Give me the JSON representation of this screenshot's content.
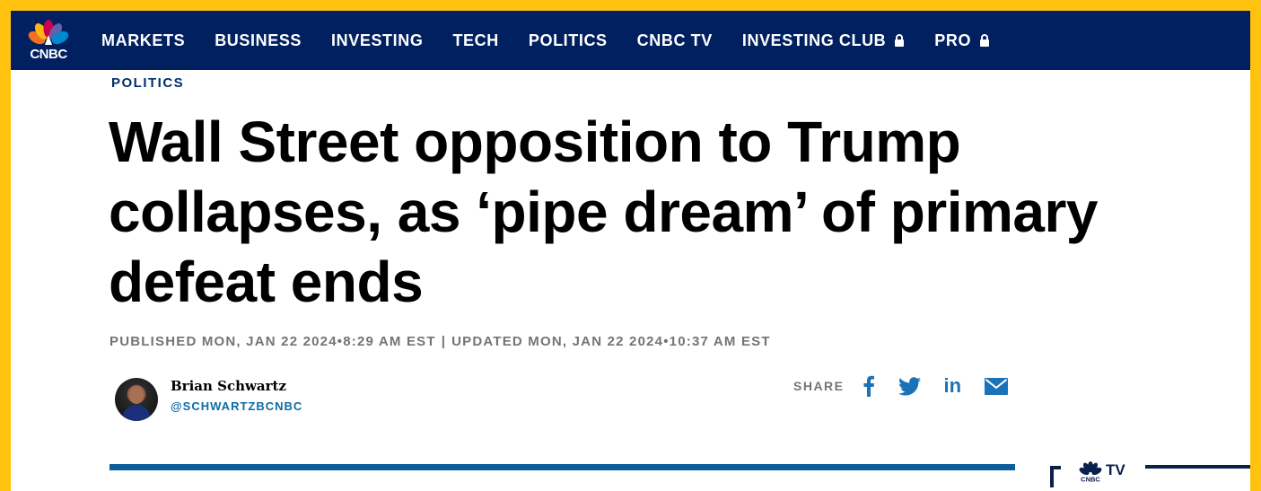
{
  "brand": {
    "logo_text": "CNBC"
  },
  "nav": {
    "items": [
      {
        "label": "MARKETS",
        "locked": false
      },
      {
        "label": "BUSINESS",
        "locked": false
      },
      {
        "label": "INVESTING",
        "locked": false
      },
      {
        "label": "TECH",
        "locked": false
      },
      {
        "label": "POLITICS",
        "locked": false
      },
      {
        "label": "CNBC TV",
        "locked": false
      },
      {
        "label": "INVESTING CLUB",
        "locked": true
      },
      {
        "label": "PRO",
        "locked": true
      }
    ]
  },
  "article": {
    "section": "POLITICS",
    "headline": "Wall Street opposition to Trump collapses, as ‘pipe dream’ of primary defeat ends",
    "published": "PUBLISHED MON, JAN 22 2024•8:29 AM EST",
    "separator": "|",
    "updated": "UPDATED MON, JAN 22 2024•10:37 AM EST"
  },
  "author": {
    "name": "Brian Schwartz",
    "handle": "@SCHWARTZBCNBC"
  },
  "share": {
    "label": "SHARE",
    "icons": [
      "facebook-icon",
      "twitter-icon",
      "linkedin-icon",
      "email-icon"
    ],
    "linkedin_text": "in"
  },
  "tv_widget": {
    "label": "TV",
    "logo_text": "CNBC"
  },
  "colors": {
    "frame": "#FFC20E",
    "navbar": "#002060",
    "section": "#002F6C",
    "meta": "#747474",
    "handle": "#0C6DA8",
    "share_icons": "#1A72B8",
    "rule": "#0C5D9B"
  }
}
